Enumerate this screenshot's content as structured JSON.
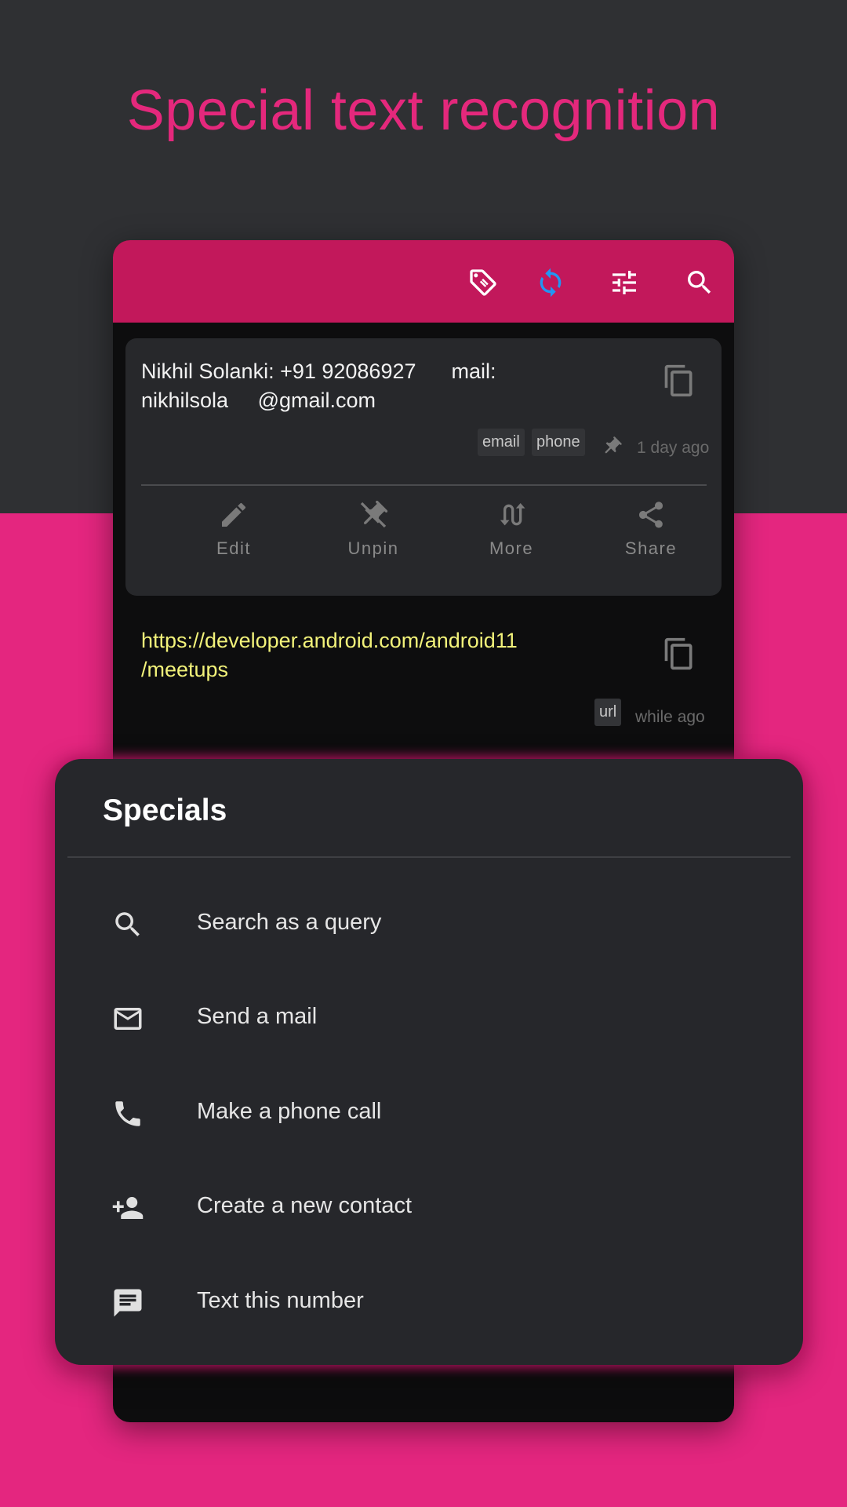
{
  "headline": "Special text recognition",
  "toolbar": {
    "icons": [
      "tag-icon",
      "sync-icon",
      "tune-icon",
      "search-icon"
    ],
    "accent": "#c2185b",
    "sync_color": "#2196f3"
  },
  "clips": [
    {
      "text_line1": "Nikhil Solanki: +91 92086927      mail:",
      "text_line2": "nikhilsola     @gmail.com",
      "tags": [
        "email",
        "phone"
      ],
      "pinned": true,
      "time": "1 day ago",
      "actions": [
        {
          "label": "Edit",
          "icon": "pencil-icon"
        },
        {
          "label": "Unpin",
          "icon": "unpin-icon"
        },
        {
          "label": "More",
          "icon": "swap-icon"
        },
        {
          "label": "Share",
          "icon": "share-icon"
        }
      ]
    },
    {
      "text_line1": "https://developer.android.com/android11",
      "text_line2": "/meetups",
      "tags": [
        "url"
      ],
      "time": "while ago",
      "text_color": "#f2f27a"
    }
  ],
  "sheet": {
    "title": "Specials",
    "items": [
      {
        "label": "Search as a query",
        "icon": "search-icon"
      },
      {
        "label": "Send a mail",
        "icon": "mail-icon"
      },
      {
        "label": "Make a phone call",
        "icon": "phone-icon"
      },
      {
        "label": "Create a new contact",
        "icon": "person-add-icon"
      },
      {
        "label": "Text this number",
        "icon": "message-icon"
      }
    ]
  },
  "colors": {
    "background_top": "#2f3033",
    "background_bottom": "#e4267f",
    "headline": "#e4287c"
  }
}
